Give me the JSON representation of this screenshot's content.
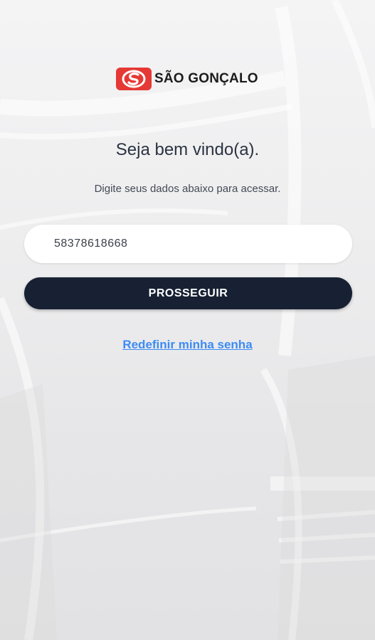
{
  "brand": {
    "name": "SÃO GONÇALO",
    "mark_color": "#e53935"
  },
  "login": {
    "welcome": "Seja bem vindo(a).",
    "subtitle": "Digite seus dados abaixo para acessar.",
    "cpf_value": "58378618668",
    "submit_label": "PROSSEGUIR",
    "reset_link": "Redefinir minha senha"
  },
  "colors": {
    "button": "#172133",
    "link": "#3d8bf5",
    "background": "#eeeeef"
  }
}
